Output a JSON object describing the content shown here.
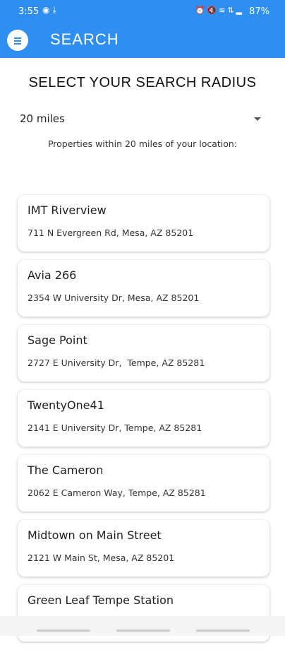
{
  "status_bar": {
    "time": "3:55",
    "battery": "87%",
    "icons": [
      "app-notification-icon",
      "download-icon",
      "alarm-icon",
      "mute-icon",
      "wifi-icon",
      "data-icon",
      "signal-icon",
      "battery-icon"
    ]
  },
  "app_bar": {
    "title": "SEARCH",
    "menu_icon": "menu-icon"
  },
  "heading": "SELECT YOUR SEARCH RADIUS",
  "radius": {
    "selected": "20 miles",
    "caption": "Properties within 20 miles of your location:"
  },
  "properties": [
    {
      "name": "IMT Riverview",
      "address": "711 N Evergreen Rd, Mesa, AZ 85201"
    },
    {
      "name": "Avia 266",
      "address": "2354 W University Dr, Mesa, AZ 85201"
    },
    {
      "name": "Sage Point",
      "address": "2727 E University Dr,  Tempe, AZ 85281"
    },
    {
      "name": "TwentyOne41",
      "address": "2141 E University Dr, Tempe, AZ 85281"
    },
    {
      "name": "The Cameron",
      "address": "2062 E Cameron Way, Tempe, AZ 85281"
    },
    {
      "name": "Midtown on Main Street",
      "address": "2121 W Main St, Mesa, AZ 85201"
    },
    {
      "name": "Green Leaf Tempe Station",
      "address": ""
    }
  ],
  "colors": {
    "primary": "#2f8ff0",
    "background": "#ffffff"
  }
}
